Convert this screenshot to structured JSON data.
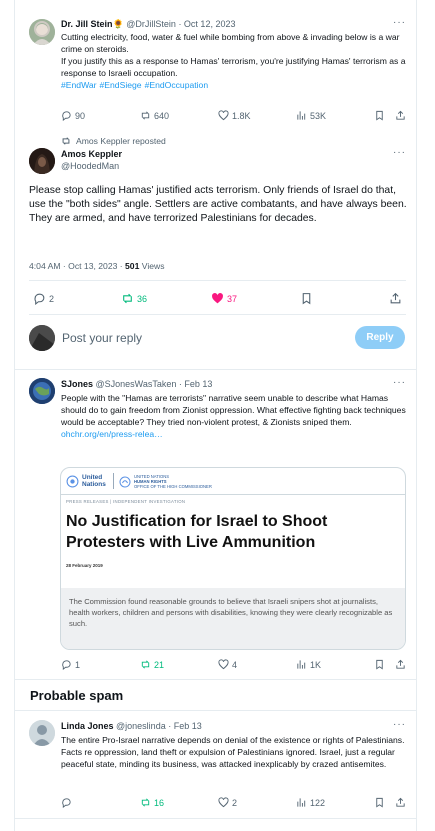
{
  "tweet1": {
    "name": "Dr. Jill Stein",
    "emoji": "🌻",
    "handle": "@DrJillStein",
    "date": "· Oct 12, 2023",
    "line1": "Cutting electricity, food, water & fuel while bombing  from above & invading below is a war crime on steroids.",
    "line2": "If you justify this as a response to Hamas' terrorism, you're justifying Hamas' terrorism as a response to Israeli occupation.",
    "hashtags": [
      "#EndWar",
      "#EndSiege",
      "#EndOccupation"
    ],
    "replies": "90",
    "reposts": "640",
    "likes": "1.8K",
    "views": "53K"
  },
  "repost_label": "Amos Keppler reposted",
  "tweet2": {
    "name": "Amos Keppler",
    "handle": "@HoodedMan",
    "text": "Please stop calling Hamas' justified acts terrorism. Only friends of Israel do that, use the \"both sides\" angle. Settlers are active combatants, and have always been. They are armed, and have terrorized Palestinians for decades.",
    "time": "4:04 AM · Oct 13, 2023 · ",
    "views_count": "501",
    "views_label": " Views",
    "replies": "2",
    "reposts": "36",
    "likes": "37"
  },
  "compose": {
    "placeholder": "Post your reply",
    "reply_label": "Reply"
  },
  "tweet3": {
    "name": "SJones",
    "handle": "@SJonesWasTaken",
    "date": "· Feb 13",
    "text": "People with the \"Hamas are terrorists\" narrative seem unable to describe what Hamas should do to gain freedom from Zionist oppression. What effective fighting back techniques would be acceptable? They tried non-violent protest, & Zionists sniped them.",
    "link": "ohchr.org/en/press-relea…",
    "card": {
      "org1_line1": "United",
      "org1_line2": "Nations",
      "org2_line1": "UNITED NATIONS",
      "org2_line2": "HUMAN RIGHTS",
      "org2_line3": "OFFICE OF THE HIGH COMMISSIONER",
      "kicker": "PRESS RELEASES | INDEPENDENT INVESTIGATION",
      "headline": "No Justification for Israel to Shoot Protesters with Live Ammunition",
      "date": "28 February 2019",
      "summary": "The Commission found reasonable grounds to believe that Israeli snipers shot at journalists, health workers, children and persons with disabilities, knowing they were clearly recognizable as such."
    },
    "replies": "1",
    "reposts": "21",
    "likes": "4",
    "views": "1K"
  },
  "spam_title": "Probable spam",
  "tweet4": {
    "name": "Linda Jones",
    "handle": "@joneslinda",
    "date": "· Feb 13",
    "text": "The entire Pro-Israel narrative depends on denial of the existence or rights of Palestinians. Facts re oppression, land theft or expulsion of Palestinians ignored. Israel, just a regular peaceful state, minding its business, was attacked inexplicably by crazed antisemites.",
    "reposts": "16",
    "likes": "2",
    "views": "122"
  },
  "colors": {
    "accent": "#1d9bf0",
    "repost_green": "#00ba7c",
    "like_pink": "#f91880",
    "muted": "#536471"
  }
}
